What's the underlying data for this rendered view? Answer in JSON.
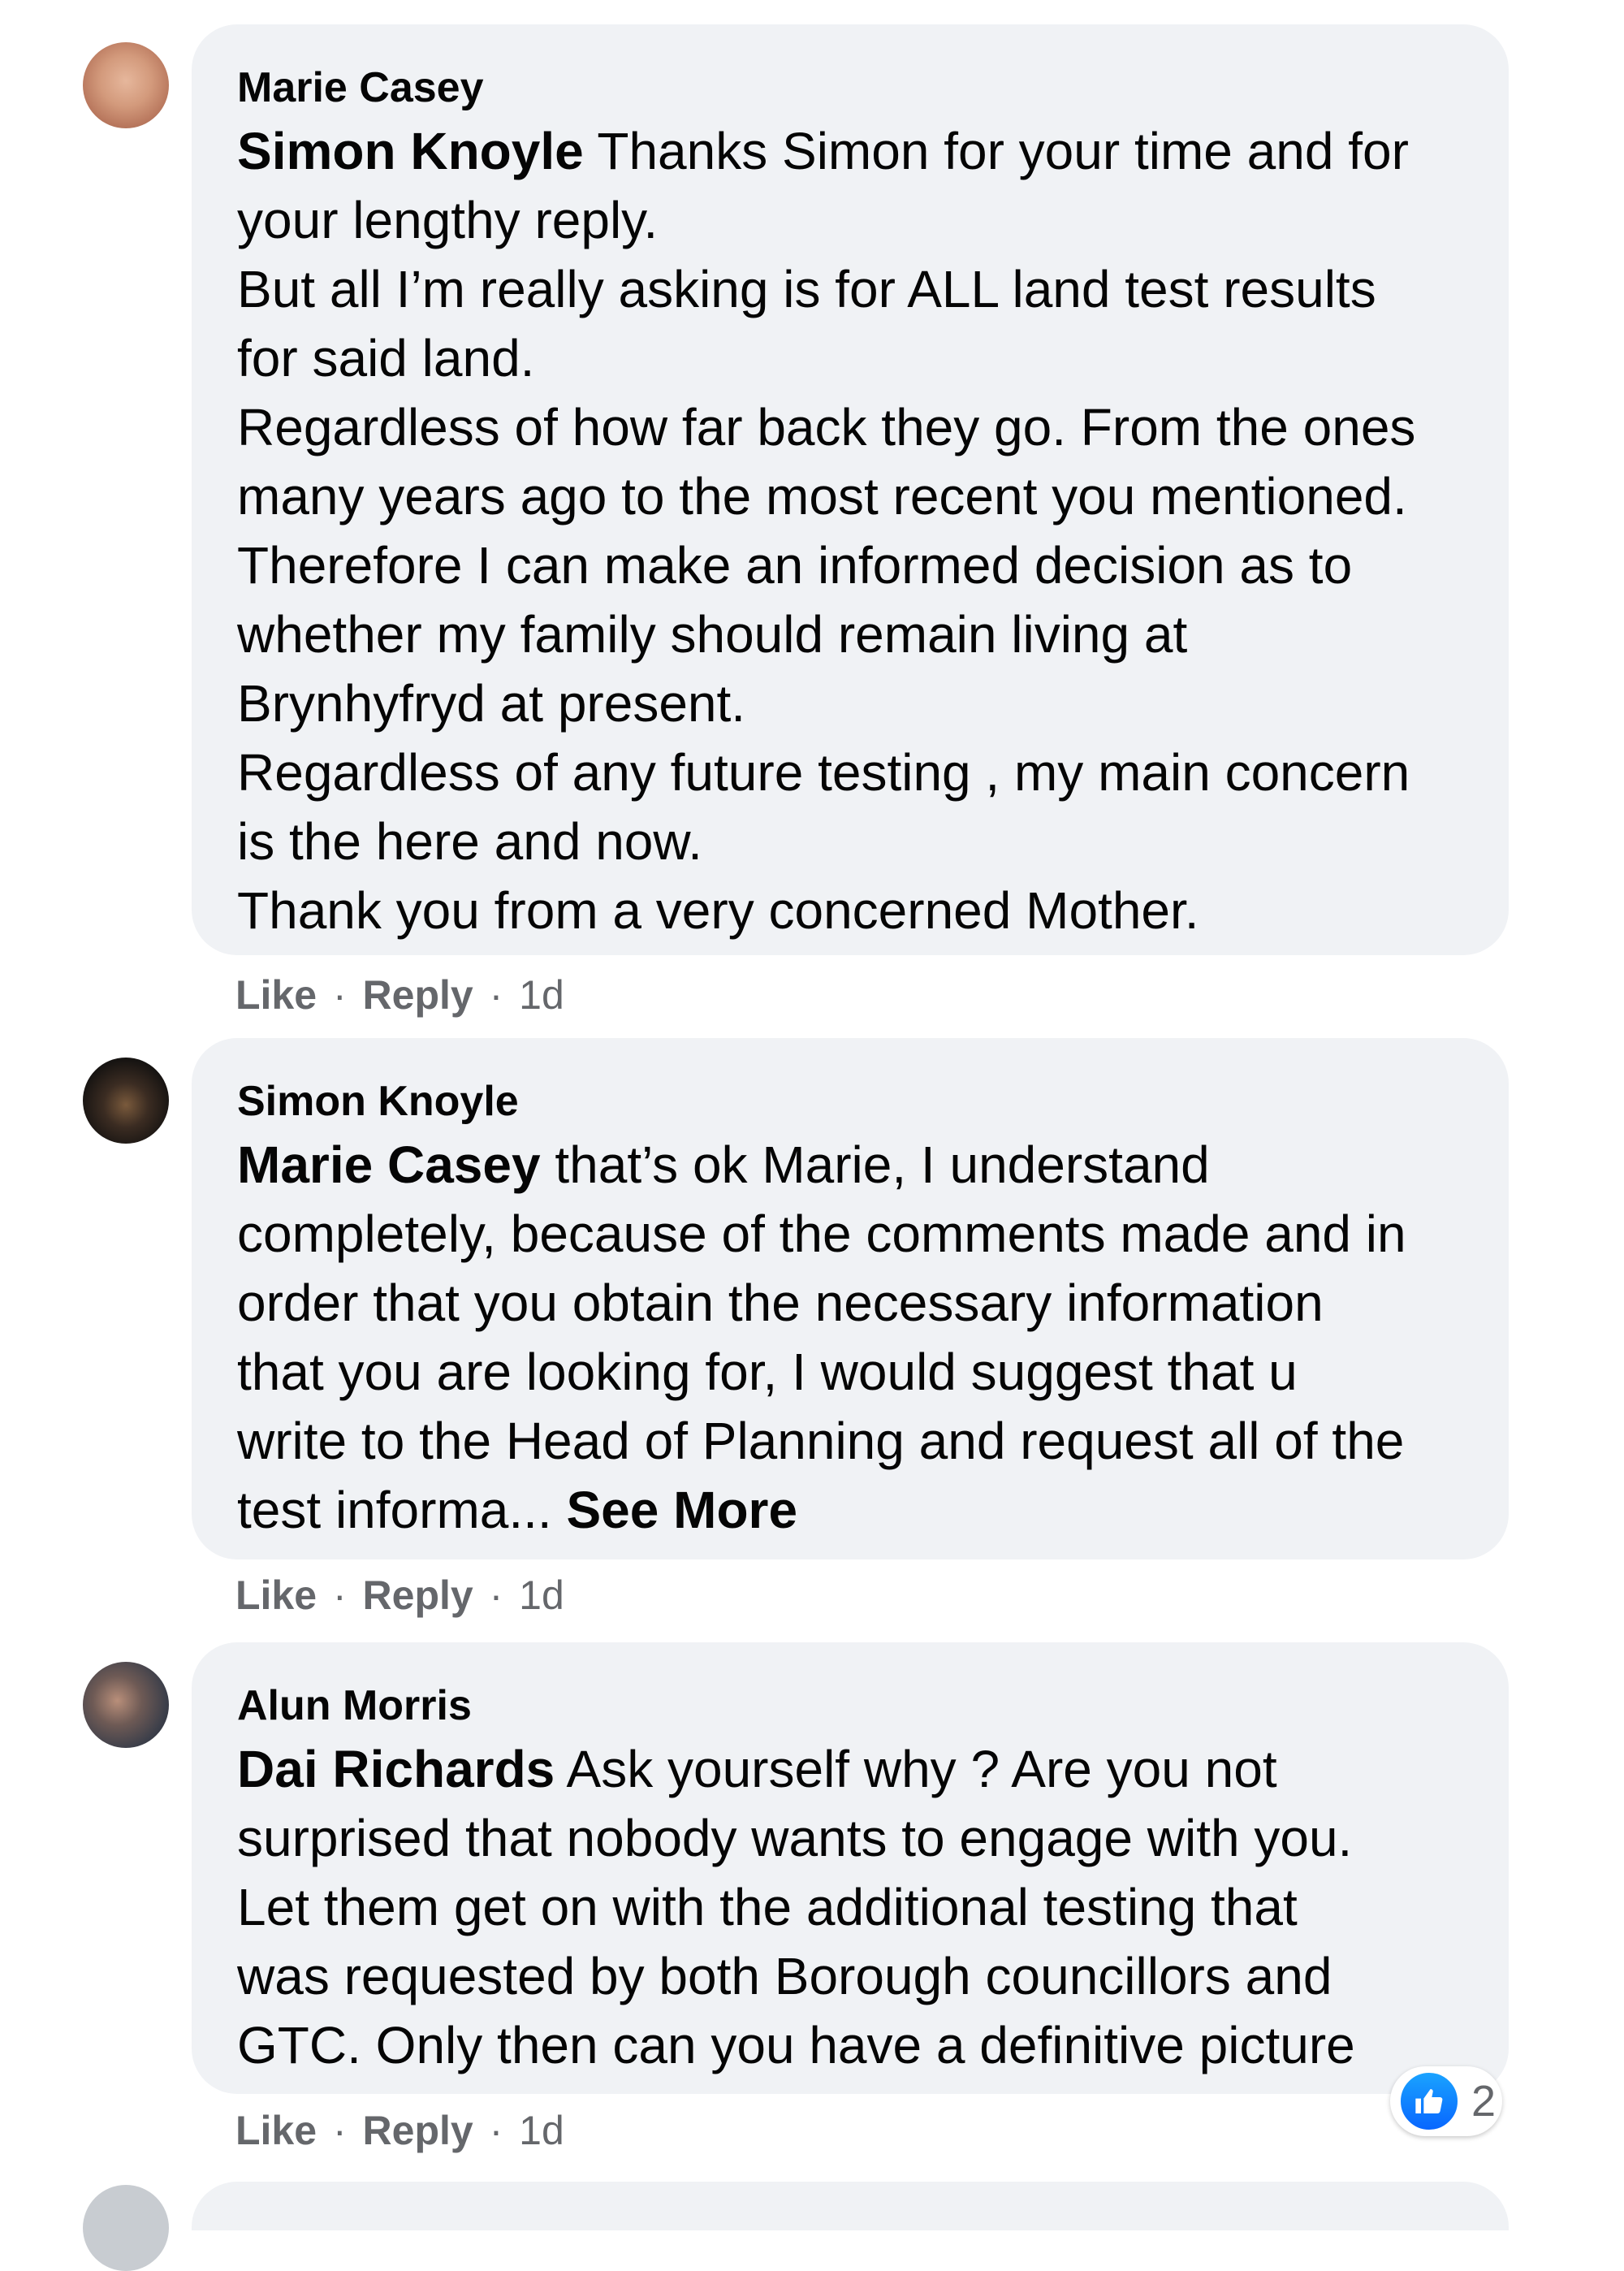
{
  "comments": [
    {
      "author": "Marie Casey",
      "mention": "Simon Knoyle",
      "lines": [
        " Thanks Simon for your time and for",
        "your lengthy reply.",
        "But all I’m really asking is for ALL land test results",
        "for said land.",
        "Regardless of how far back they go. From the ones",
        "many years ago to the most recent you mentioned.",
        "Therefore I can make an informed decision as to",
        "whether my family should remain living at",
        "Brynhyfryd at present.",
        "Regardless of any future testing , my main concern",
        "is the here and now.",
        "Thank you from a very concerned Mother."
      ],
      "like": "Like",
      "reply": "Reply",
      "dot": "·",
      "time": "1d"
    },
    {
      "author": "Simon Knoyle",
      "mention": "Marie Casey",
      "lines": [
        " that’s ok Marie, I understand",
        "completely, because of the comments made and in",
        "order that you obtain the necessary information",
        "that you are looking for, I would suggest that u",
        "write to the Head of Planning and request all of the",
        "test informa... "
      ],
      "see_more": "See More",
      "like": "Like",
      "reply": "Reply",
      "dot": "·",
      "time": "1d"
    },
    {
      "author": "Alun Morris",
      "mention": "Dai Richards",
      "lines": [
        " Ask yourself why ? Are you not",
        "surprised that nobody wants to engage with you.",
        "Let them get on with the additional testing that",
        "was requested by both Borough councillors and",
        "GTC. Only then can you have a definitive picture"
      ],
      "like": "Like",
      "reply": "Reply",
      "dot": "·",
      "time": "1d",
      "reaction_count": "2"
    }
  ],
  "colors": {
    "bubble": "#f0f2f5",
    "text": "#050505",
    "meta": "#65676b",
    "like_blue": "#0866ff"
  },
  "icons": {
    "reaction": "thumbs-up-icon"
  }
}
